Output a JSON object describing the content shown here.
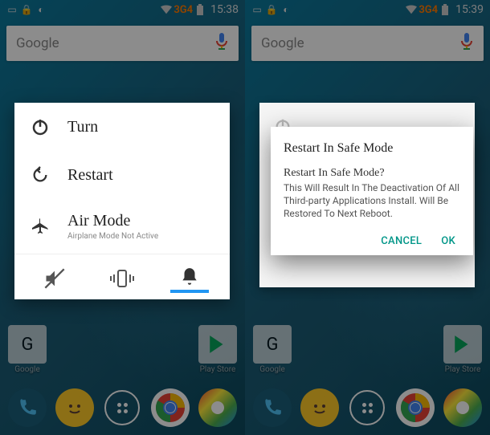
{
  "left": {
    "status": {
      "time": "15:38",
      "signal": "3G4"
    },
    "search": {
      "text": "Google"
    },
    "power_menu": {
      "turn": "Turn",
      "restart": "Restart",
      "air_mode": "Air Mode",
      "air_sub": "Airplane Mode Not Active"
    },
    "apps": {
      "google": "Google",
      "playstore": "Play Store"
    }
  },
  "right": {
    "status": {
      "time": "15:39",
      "signal": "3G4"
    },
    "search": {
      "text": "Google"
    },
    "dialog": {
      "title": "Restart In Safe Mode",
      "subtitle": "Restart In Safe Mode?",
      "body": "This Will Result In The Deactivation Of All Third-party Applications Install. Will Be Restored To Next Reboot.",
      "cancel": "CANCEL",
      "ok": "OK"
    },
    "apps": {
      "google": "Google",
      "playstore": "Play Store"
    }
  }
}
